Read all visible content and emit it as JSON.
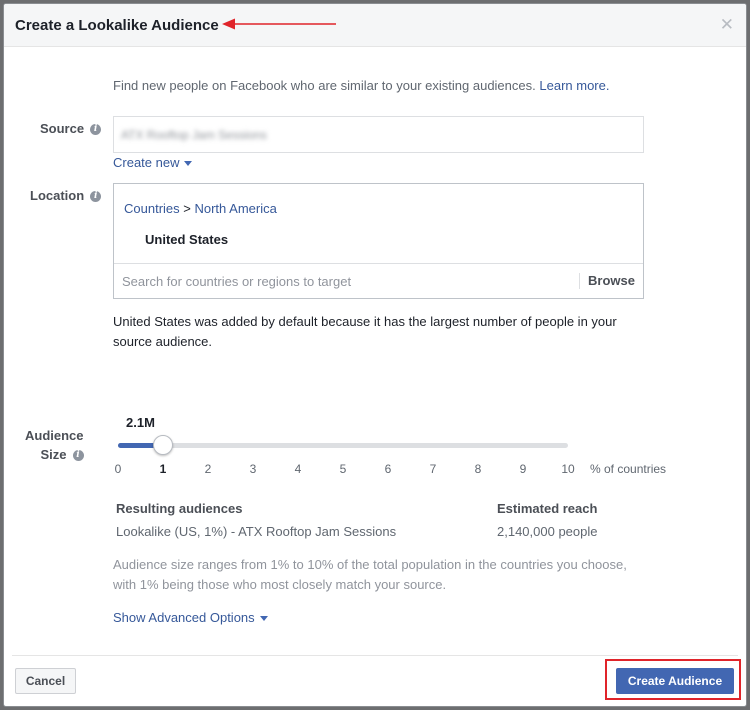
{
  "dialog": {
    "title": "Create a Lookalike Audience",
    "close_icon": "close-icon",
    "annotation_color": "#e0242a"
  },
  "intro": {
    "text": "Find new people on Facebook who are similar to your existing audiences.",
    "learn_more": "Learn more."
  },
  "source": {
    "label": "Source",
    "value": "ATX Rooftop Jam Sessions",
    "create_new": "Create new"
  },
  "location": {
    "label": "Location",
    "crumb_root": "Countries",
    "crumb_sep": ">",
    "crumb_region": "North America",
    "selected": "United States",
    "search_placeholder": "Search for countries or regions to target",
    "browse": "Browse",
    "note": "United States was added by default because it has the largest number of people in your source audience."
  },
  "audience_size": {
    "label_line1": "Audience",
    "label_line2": "Size",
    "value_display": "2.1M",
    "selected_percent": 1,
    "ticks": [
      "0",
      "1",
      "2",
      "3",
      "4",
      "5",
      "6",
      "7",
      "8",
      "9",
      "10"
    ],
    "suffix": "% of countries"
  },
  "results": {
    "col1_header": "Resulting audiences",
    "col1_value": "Lookalike (US, 1%) - ATX Rooftop Jam Sessions",
    "col2_header": "Estimated reach",
    "col2_value": "2,140,000 people"
  },
  "range_note": "Audience size ranges from 1% to 10% of the total population in the countries you choose, with 1% being those who most closely match your source.",
  "advanced": "Show Advanced Options",
  "footer": {
    "cancel": "Cancel",
    "create": "Create Audience"
  },
  "colors": {
    "brand": "#4267b2",
    "link": "#365899"
  }
}
